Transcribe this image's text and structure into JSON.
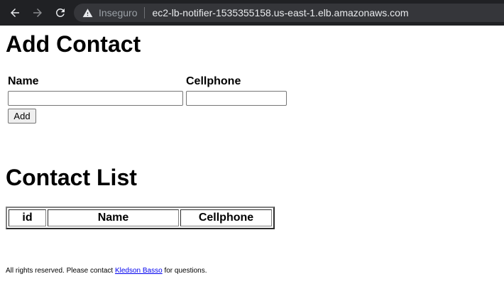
{
  "browser": {
    "security_label": "Inseguro",
    "url": "ec2-lb-notifier-1535355158.us-east-1.elb.amazonaws.com",
    "icons": [
      "back-arrow-icon",
      "forward-arrow-icon",
      "reload-icon",
      "warning-icon"
    ]
  },
  "add_contact": {
    "title": "Add Contact",
    "name_label": "Name",
    "cellphone_label": "Cellphone",
    "name_value": "",
    "cellphone_value": "",
    "add_button": "Add"
  },
  "contact_list": {
    "title": "Contact List",
    "columns": [
      "id",
      "Name",
      "Cellphone"
    ],
    "rows": []
  },
  "footer": {
    "text_before": "All rights reserved. Please contact ",
    "link_text": "Kledson Basso",
    "text_after": " for questions."
  }
}
